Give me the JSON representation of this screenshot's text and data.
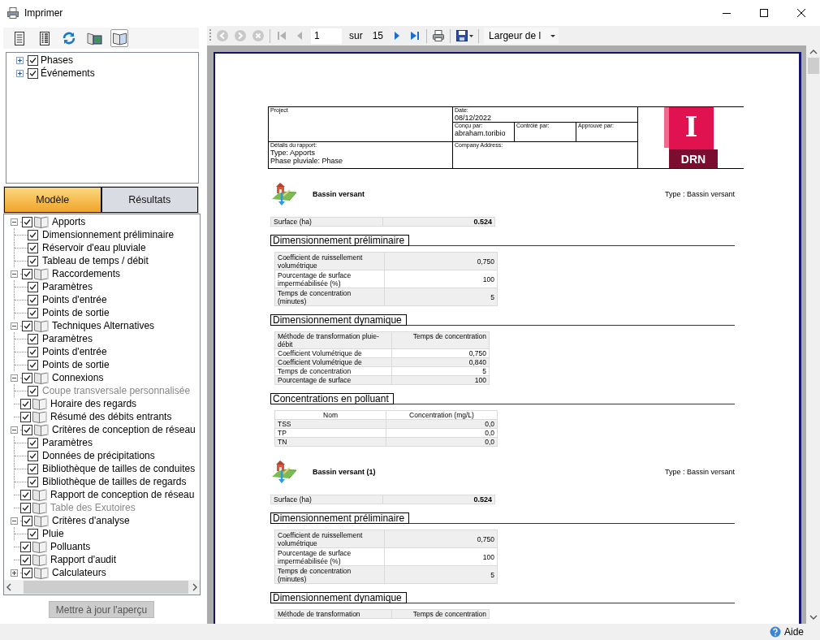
{
  "window": {
    "title": "Imprimer"
  },
  "left_toolbar": [
    {
      "kind": "page",
      "pressed": false
    },
    {
      "kind": "list",
      "pressed": false
    },
    {
      "kind": "refresh",
      "pressed": false
    },
    {
      "kind": "book-picture",
      "pressed": false
    },
    {
      "kind": "book",
      "pressed": true
    }
  ],
  "filter_tree": {
    "kind": "filters",
    "items": [
      {
        "label": "Phases",
        "checked": true,
        "expanded": false,
        "disabled": false
      },
      {
        "label": "Événements",
        "checked": true,
        "expanded": false,
        "disabled": false
      }
    ]
  },
  "tabs": [
    {
      "label": "Modèle",
      "selected": true
    },
    {
      "label": "Résultats",
      "selected": false
    }
  ],
  "report_tree": {
    "kind": "reports",
    "items": [
      {
        "label": "Apports",
        "checked": true,
        "expanded": true,
        "disabled": false,
        "children": [
          {
            "label": "Dimensionnement préliminaire",
            "checked": true,
            "disabled": false
          },
          {
            "label": "Réservoir d'eau pluviale",
            "checked": true,
            "disabled": false
          },
          {
            "label": "Tableau de temps / débit",
            "checked": true,
            "disabled": false
          }
        ]
      },
      {
        "label": "Raccordements",
        "checked": true,
        "expanded": true,
        "disabled": false,
        "children": [
          {
            "label": "Paramètres",
            "checked": true,
            "disabled": false
          },
          {
            "label": "Points d'entrée",
            "checked": true,
            "disabled": false
          },
          {
            "label": "Points de sortie",
            "checked": true,
            "disabled": false
          }
        ]
      },
      {
        "label": "Techniques Alternatives",
        "checked": true,
        "expanded": true,
        "disabled": false,
        "children": [
          {
            "label": "Paramètres",
            "checked": true,
            "disabled": false
          },
          {
            "label": "Points d'entrée",
            "checked": true,
            "disabled": false
          },
          {
            "label": "Points de sortie",
            "checked": true,
            "disabled": false
          }
        ]
      },
      {
        "label": "Connexions",
        "checked": true,
        "expanded": true,
        "disabled": false,
        "children": [
          {
            "label": "Coupe transversale personnalisée",
            "checked": true,
            "disabled": true
          }
        ]
      },
      {
        "label": "Horaire des regards",
        "checked": true,
        "disabled": false
      },
      {
        "label": "Résumé des débits entrants",
        "checked": true,
        "disabled": false
      },
      {
        "label": "Critères de conception de réseau",
        "checked": true,
        "expanded": true,
        "disabled": false,
        "children": [
          {
            "label": "Paramètres",
            "checked": true,
            "disabled": false
          },
          {
            "label": "Données de précipitations",
            "checked": true,
            "disabled": false
          },
          {
            "label": "Bibliothèque de tailles de conduites",
            "checked": true,
            "disabled": false
          },
          {
            "label": "Bibliothèque de tailles de regards",
            "checked": true,
            "disabled": false
          }
        ]
      },
      {
        "label": "Rapport de conception de réseau",
        "checked": true,
        "disabled": false
      },
      {
        "label": "Table des Exutoires",
        "checked": true,
        "disabled": true
      },
      {
        "label": "Critères d'analyse",
        "checked": true,
        "expanded": true,
        "disabled": false,
        "children": [
          {
            "label": "Pluie",
            "checked": true,
            "disabled": false
          }
        ]
      },
      {
        "label": "Polluants",
        "checked": true,
        "disabled": false
      },
      {
        "label": "Rapport d'audit",
        "checked": true,
        "disabled": false
      },
      {
        "label": "Calculateurs",
        "checked": true,
        "expanded": false,
        "disabled": false
      }
    ]
  },
  "update_button": {
    "label": "Mettre à jour l'aperçu",
    "disabled": true
  },
  "viewer_toolbar": {
    "items": [
      {
        "kind": "back",
        "disabled": true
      },
      {
        "kind": "forward",
        "disabled": true
      },
      {
        "kind": "stop",
        "disabled": true
      },
      {
        "kind": "separator"
      },
      {
        "kind": "first",
        "disabled": true
      },
      {
        "kind": "previous",
        "disabled": true
      },
      {
        "kind": "page-field",
        "value": "1"
      },
      {
        "kind": "label",
        "text": "sur"
      },
      {
        "kind": "label",
        "text": "15"
      },
      {
        "kind": "next",
        "disabled": false
      },
      {
        "kind": "last",
        "disabled": false
      },
      {
        "kind": "separator"
      },
      {
        "kind": "print",
        "disabled": false
      },
      {
        "kind": "separator"
      },
      {
        "kind": "save",
        "disabled": false
      },
      {
        "kind": "separator"
      },
      {
        "kind": "zoom",
        "value": "Largeur de l"
      }
    ]
  },
  "report": {
    "header": {
      "project_label": "Project",
      "date_label": "Date:",
      "date": "08/12/2022",
      "designed_label": "Conçu par:",
      "designed_by": "abraham.toribio",
      "checked_label": "Contrôlé par:",
      "approved_label": "Approuvé par:",
      "details_label": "Détails du rapport:",
      "details": [
        "Type: Apports",
        "Phase pluviale: Phase"
      ],
      "address_label": "Company Address:",
      "logo": {
        "letter": "I",
        "text": "DRN"
      }
    },
    "catchments": [
      {
        "title": "Bassin versant",
        "type": "Type : Bassin versant",
        "surface": [
          "Surface (ha)",
          "0.524"
        ],
        "sections": [
          {
            "title": "Dimensionnement préliminaire",
            "kind": "params",
            "rows": [
              [
                "Coefficient de ruissellement volumétrique",
                "0,750"
              ],
              [
                "Pourcentage de surface imperméabilisée (%)",
                "100"
              ],
              [
                "Temps de concentration (minutes)",
                "5"
              ]
            ]
          },
          {
            "title": "Dimensionnement dynamique",
            "kind": "method",
            "header": [
              "Méthode de transformation pluie-débit",
              "Temps de concentration"
            ],
            "rows": [
              [
                "Coefficient Volumétrique de",
                "0,750"
              ],
              [
                "Coefficient Volumétrique de",
                "0,840"
              ],
              [
                "Temps de concentration",
                "5"
              ],
              [
                "Pourcentage de surface",
                "100"
              ]
            ]
          },
          {
            "title": "Concentrations en polluant",
            "kind": "listing",
            "header": [
              "Nom",
              "Concentration (mg/L)"
            ],
            "rows": [
              [
                "TSS",
                "0,0"
              ],
              [
                "TP",
                "0,0"
              ],
              [
                "TN",
                "0,0"
              ]
            ]
          }
        ]
      },
      {
        "title": "Bassin versant (1)",
        "type": "Type : Bassin versant",
        "surface": [
          "Surface (ha)",
          "0.524"
        ],
        "sections": [
          {
            "title": "Dimensionnement préliminaire",
            "kind": "params",
            "rows": [
              [
                "Coefficient de ruissellement volumétrique",
                "0,750"
              ],
              [
                "Pourcentage de surface imperméabilisée (%)",
                "100"
              ],
              [
                "Temps de concentration (minutes)",
                "5"
              ]
            ]
          },
          {
            "title": "Dimensionnement dynamique",
            "kind": "method",
            "header": [
              "Méthode de transformation",
              "Temps de concentration"
            ]
          }
        ]
      }
    ]
  },
  "status_bar": {
    "help": "Aide"
  }
}
